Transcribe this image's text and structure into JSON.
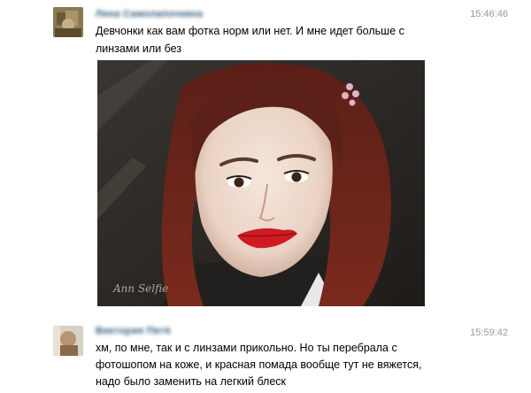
{
  "messages": [
    {
      "author": "Лена Самолапочкина",
      "time": "15:46:46",
      "text": "Девчонки как вам фотка норм или нет. И мне идет больше с линзами или без",
      "attachment": {
        "type": "photo",
        "watermark": "Ann Selfie"
      }
    },
    {
      "author": "Виктория Пятё",
      "time": "15:59:42",
      "text": "хм, по мне, так и с линзами прикольно. Но ты перебрала с фотошопом на коже, и красная помада вообще тут не вяжется, надо было заменить на легкий блеск"
    }
  ]
}
